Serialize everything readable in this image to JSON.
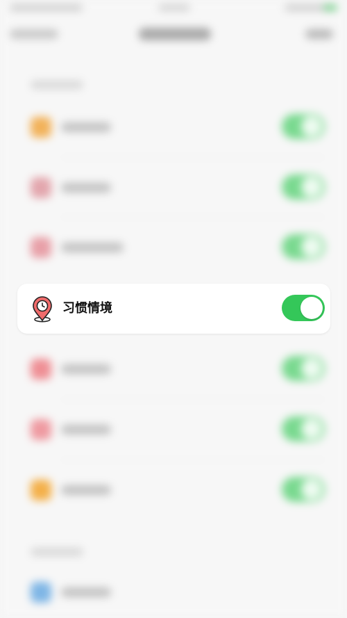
{
  "focused_setting": {
    "label": "习惯情境",
    "icon": "location-clock-icon",
    "enabled": true,
    "accent_color": "#34c759",
    "icon_color": "#ef6b6b"
  },
  "background_rows": [
    {
      "icon_color": "#f2b25a"
    },
    {
      "icon_color": "#e3a6ad"
    },
    {
      "icon_color": "#e8a0a8"
    },
    {
      "icon_color": "#ef8f95"
    },
    {
      "icon_color": "#ef9aa1"
    },
    {
      "icon_color": "#f4b04a"
    },
    {
      "icon_color": "#7fb6e6"
    }
  ]
}
